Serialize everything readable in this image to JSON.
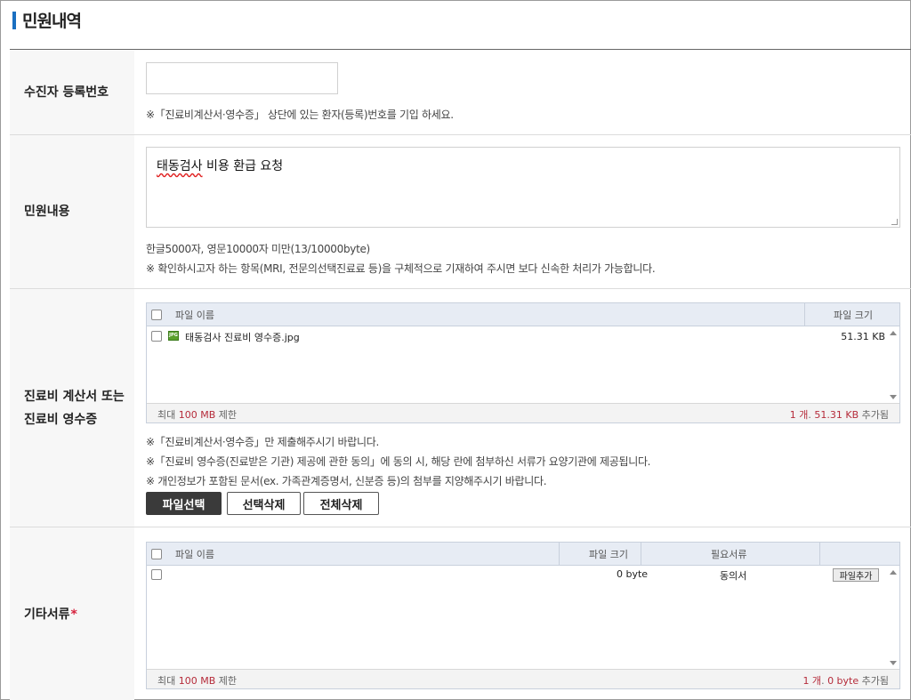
{
  "page": {
    "title": "민원내역"
  },
  "rows": {
    "registration": {
      "label": "수진자 등록번호",
      "input_value": "",
      "note": "※「진료비계산서·영수증」 상단에 있는 환자(등록)번호를 기입 하세요."
    },
    "content": {
      "label": "민원내용",
      "text_before": "",
      "text_squiggle": "태동검사",
      "text_after": " 비용 환급 요청",
      "limit_note": "한글5000자, 영문10000자 미만(13/10000byte)",
      "hint_note": "※ 확인하시고자 하는 항목(MRI, 전문의선택진료료 등)을 구체적으로 기재하여 주시면 보다 신속한 처리가 가능합니다."
    },
    "receipt": {
      "label_line1": "진료비 계산서 또는",
      "label_line2": "진료비 영수증",
      "table": {
        "col_name": "파일 이름",
        "col_size": "파일 크기",
        "files": [
          {
            "name": "태동검사 진료비 영수증.jpg",
            "size": "51.31 KB",
            "icon": "jpg-file-icon"
          }
        ],
        "footer_left_prefix": "최대 ",
        "footer_left_value": "100 MB",
        "footer_left_suffix": " 제한",
        "footer_right_count": "1 개",
        "footer_right_sep": ". ",
        "footer_right_size": "51.31 KB",
        "footer_right_suffix": " 추가됨"
      },
      "notes": [
        "※「진료비계산서·영수증」만 제출해주시기 바랍니다.",
        "※「진료비 영수증(진료받은 기관) 제공에 관한 동의」에 동의 시, 해당 란에 첨부하신 서류가 요양기관에 제공됩니다.",
        "※ 개인정보가 포함된 문서(ex. 가족관계증명서, 신분증 등)의 첨부를 지양해주시기 바랍니다."
      ],
      "buttons": {
        "select": "파일선택",
        "delete_selected": "선택삭제",
        "delete_all": "전체삭제"
      }
    },
    "other": {
      "label": "기타서류",
      "required_mark": "*",
      "table": {
        "col_name": "파일 이름",
        "col_size": "파일 크기",
        "col_doc": "필요서류",
        "rows": [
          {
            "name": "",
            "size": "0 byte",
            "doc": "동의서",
            "action": "파일추가"
          }
        ],
        "footer_left_prefix": "최대 ",
        "footer_left_value": "100 MB",
        "footer_left_suffix": " 제한",
        "footer_right_count": "1 개",
        "footer_right_sep": ". ",
        "footer_right_size": "0 byte",
        "footer_right_suffix": " 추가됨"
      }
    }
  },
  "colors": {
    "accent": "#1a6fc1",
    "required": "#d6213d",
    "highlight": "#b52b3a",
    "dark_button": "#3a3a3a"
  }
}
